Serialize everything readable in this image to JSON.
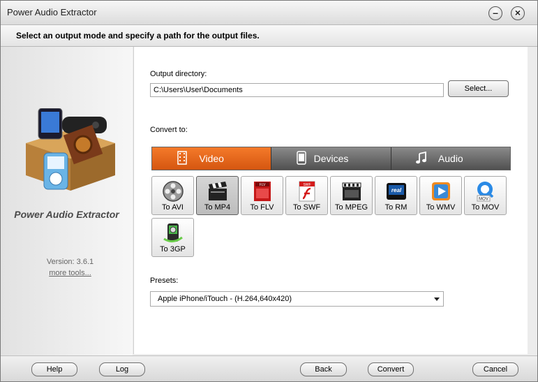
{
  "window": {
    "title": "Power Audio Extractor"
  },
  "header": {
    "instruction": "Select an output mode and specify a path for the output files."
  },
  "sidebar": {
    "app_name": "Power Audio Extractor",
    "version": "Version: 3.6.1",
    "more_tools": "more tools..."
  },
  "output": {
    "label": "Output directory:",
    "value": "C:\\Users\\User\\Documents",
    "select_button": "Select..."
  },
  "convert": {
    "label": "Convert to:",
    "tabs": [
      {
        "label": "Video",
        "active": true
      },
      {
        "label": "Devices",
        "active": false
      },
      {
        "label": "Audio",
        "active": false
      }
    ],
    "formats": [
      {
        "label": "To AVI"
      },
      {
        "label": "To MP4",
        "selected": true
      },
      {
        "label": "To FLV"
      },
      {
        "label": "To SWF"
      },
      {
        "label": "To MPEG"
      },
      {
        "label": "To RM"
      },
      {
        "label": "To WMV"
      },
      {
        "label": "To MOV"
      },
      {
        "label": "To 3GP"
      }
    ]
  },
  "presets": {
    "label": "Presets:",
    "selected": "Apple iPhone/iTouch - (H.264,640x420)"
  },
  "icons": {
    "avi": "film-reel-icon",
    "mp4": "clapperboard-icon",
    "flv": "flash-video-icon",
    "swf": "flash-icon",
    "mpeg": "mpeg-clapperboard-icon",
    "rm": "real-media-icon",
    "wmv": "media-player-icon",
    "mov": "quicktime-icon",
    "3gp": "mobile-film-icon"
  },
  "footer": {
    "help": "Help",
    "log": "Log",
    "back": "Back",
    "convert": "Convert",
    "cancel": "Cancel"
  }
}
